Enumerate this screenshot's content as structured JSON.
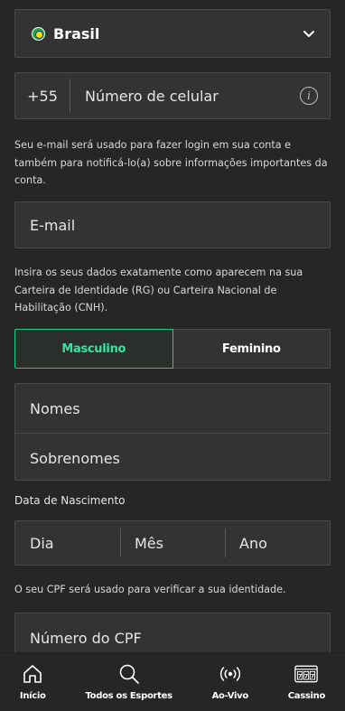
{
  "country_select": {
    "label": "Brasil"
  },
  "phone": {
    "code": "+55",
    "placeholder": "Número de celular"
  },
  "email_note": "Seu e-mail será usado para fazer login em sua conta e também para notificá-lo(a) sobre informações importantes da conta.",
  "email": {
    "placeholder": "E-mail"
  },
  "id_note": "Insira os seus dados exatamente como aparecem na sua Carteira de Identidade (RG) ou Carteira Nacional de Habilitação (CNH).",
  "gender": {
    "male": "Masculino",
    "female": "Feminino",
    "selected": "Masculino"
  },
  "names": {
    "first_placeholder": "Nomes",
    "last_placeholder": "Sobrenomes"
  },
  "dob": {
    "label": "Data de Nascimento",
    "day": "Dia",
    "month": "Mês",
    "year": "Ano"
  },
  "cpf_note": "O seu CPF será usado para verificar a sua identidade.",
  "cpf": {
    "placeholder": "Número do CPF"
  },
  "bottom_nav": [
    {
      "label": "Início",
      "icon": "home-icon"
    },
    {
      "label": "Todos os Esportes",
      "icon": "search-icon"
    },
    {
      "label": "Ao-Vivo",
      "icon": "live-broadcast-icon"
    },
    {
      "label": "Cassino",
      "icon": "slot-machine-icon"
    }
  ],
  "colors": {
    "accent": "#36e3a1",
    "background": "#262626",
    "field": "#333333"
  }
}
